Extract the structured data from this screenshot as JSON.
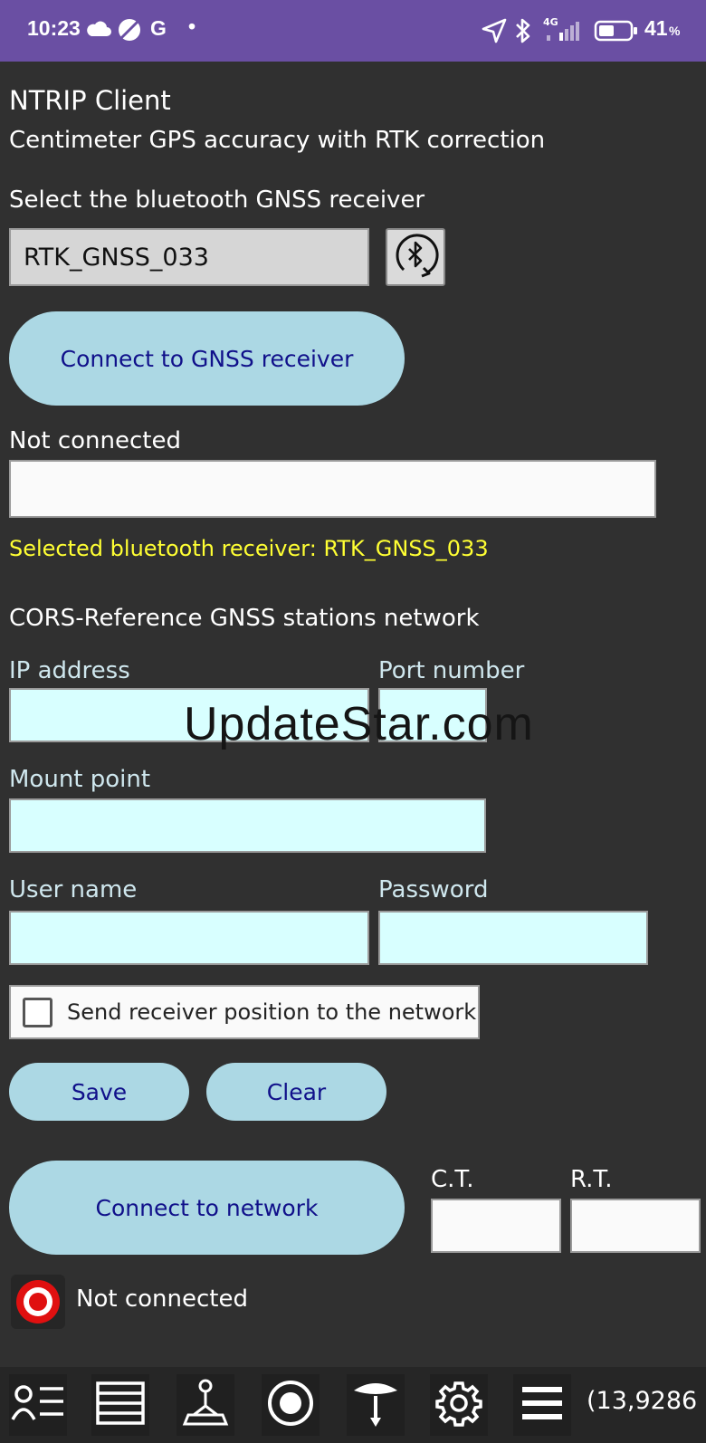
{
  "status_bar": {
    "time": "10:23",
    "g_label": "G",
    "dot": "•",
    "network_type": "4G",
    "battery_percent": "41",
    "battery_unit": "%",
    "icons": [
      "cloud-icon",
      "no-sim-icon",
      "google-icon",
      "location-arrow-icon",
      "bluetooth-icon",
      "signal-icon",
      "battery-icon"
    ],
    "color": "#6a4fa3"
  },
  "header": {
    "title": "NTRIP Client",
    "subtitle": "Centimeter GPS accuracy with RTK correction"
  },
  "receiver": {
    "select_label": "Select the bluetooth GNSS receiver",
    "selected_device": "RTK_GNSS_033",
    "refresh_icon": "bluetooth-refresh-icon",
    "connect_label": "Connect to GNSS receiver",
    "status": "Not connected",
    "status_field_value": "",
    "info": "Selected bluetooth receiver: RTK_GNSS_033"
  },
  "network": {
    "section_title": "CORS-Reference GNSS stations network",
    "ip_label": "IP address",
    "ip_value": "",
    "port_label": "Port number",
    "port_value": "",
    "mount_label": "Mount point",
    "mount_value": "",
    "user_label": "User name",
    "user_value": "",
    "password_label": "Password",
    "password_value": "",
    "send_position_label": "Send receiver position to the network",
    "send_position_checked": false,
    "save_label": "Save",
    "clear_label": "Clear",
    "connect_label": "Connect to network",
    "ct_label": "C.T.",
    "ct_value": "",
    "rt_label": "R.T.",
    "rt_value": "",
    "status": "Not connected",
    "status_icon": "record-status-icon"
  },
  "watermark": "UpdateStar.com",
  "bottom_nav": {
    "items": [
      "user-list-icon",
      "table-icon",
      "survey-point-icon",
      "record-icon",
      "antenna-icon",
      "gear-icon",
      "menu-icon"
    ],
    "coordinates": "(13,9286"
  },
  "colors": {
    "background": "#303030",
    "button": "#acd8e4",
    "button_text": "#10108a",
    "input_fill": "#d8ffff",
    "info_text": "#ffff33",
    "status_red": "#e01010"
  }
}
